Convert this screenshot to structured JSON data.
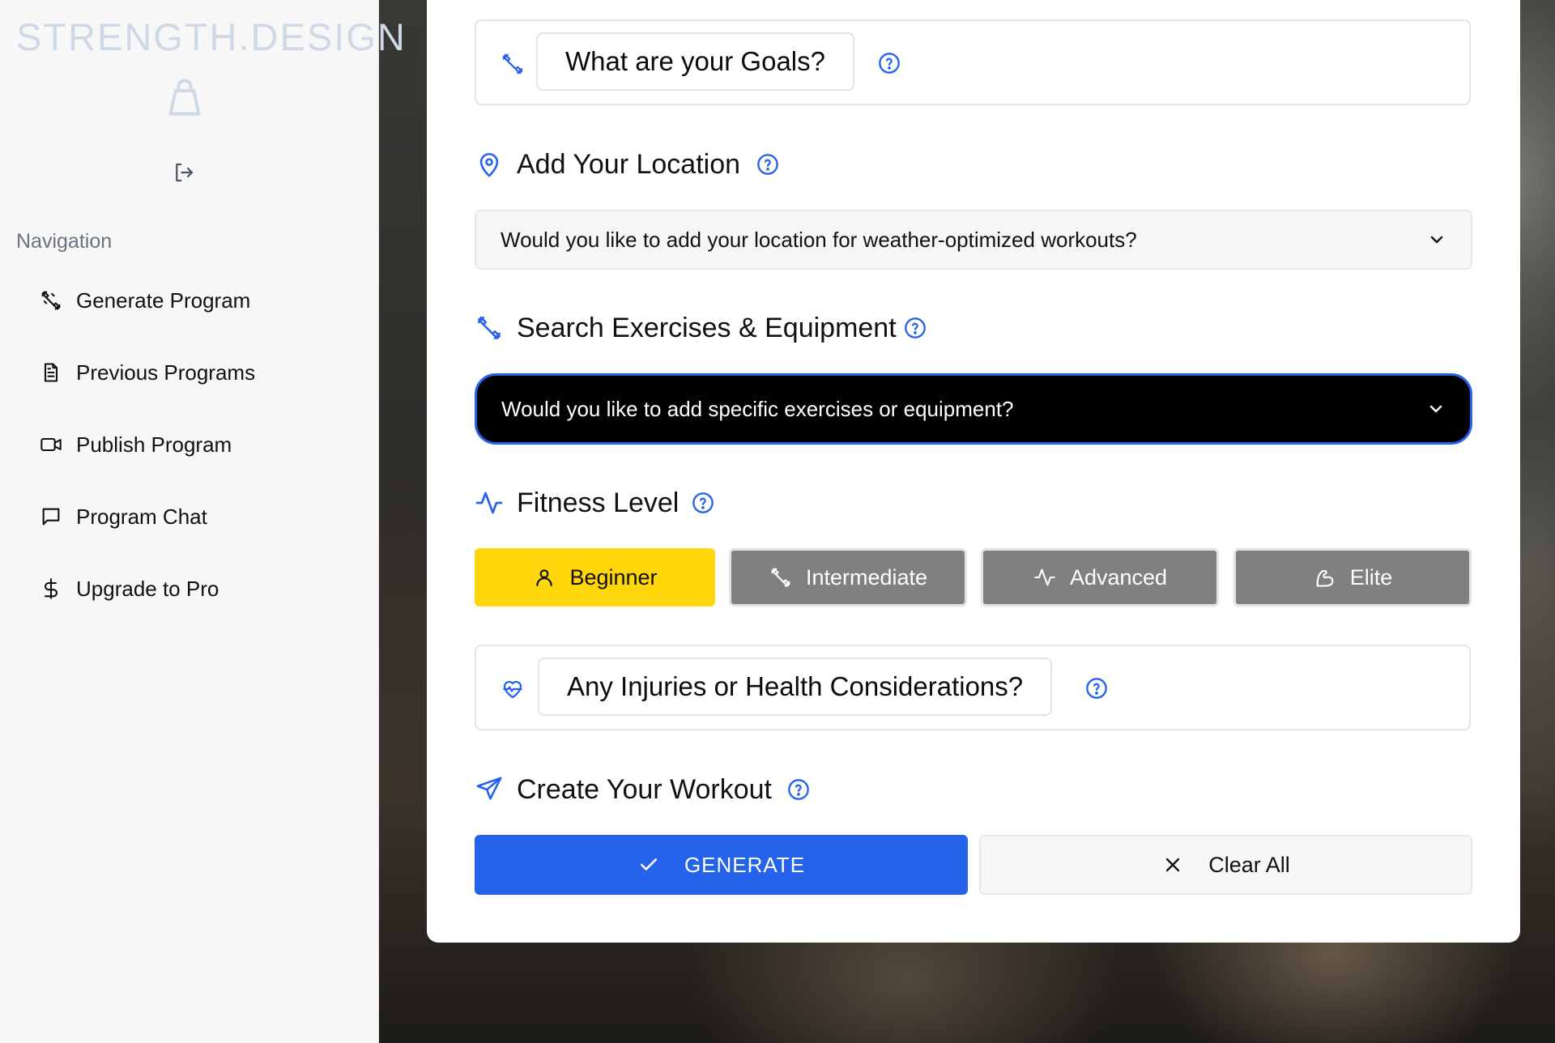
{
  "sidebar": {
    "brand": "STRENGTH.DESIGN",
    "brand_icon": "kettlebell-icon",
    "logout_icon": "logout-icon",
    "nav_heading": "Navigation",
    "items": [
      {
        "label": "Generate Program",
        "icon": "dumbbell-icon"
      },
      {
        "label": "Previous Programs",
        "icon": "document-icon"
      },
      {
        "label": "Publish Program",
        "icon": "video-icon"
      },
      {
        "label": "Program Chat",
        "icon": "chat-icon"
      },
      {
        "label": "Upgrade to Pro",
        "icon": "dollar-icon"
      }
    ]
  },
  "main": {
    "goals": {
      "label": "What are your Goals?",
      "icon": "dumbbell-icon"
    },
    "location": {
      "title": "Add Your Location",
      "icon": "map-pin-icon",
      "dropdown": "Would you like to add your location for weather-optimized workouts?"
    },
    "exercises": {
      "title": "Search Exercises & Equipment",
      "icon": "dumbbell-icon",
      "dropdown": "Would you like to add specific exercises or equipment?"
    },
    "fitness": {
      "title": "Fitness Level",
      "icon": "activity-icon",
      "selected": "Beginner",
      "levels": [
        {
          "label": "Beginner",
          "icon": "user-icon"
        },
        {
          "label": "Intermediate",
          "icon": "dumbbell-icon"
        },
        {
          "label": "Advanced",
          "icon": "activity-icon"
        },
        {
          "label": "Elite",
          "icon": "flexed-arm-icon"
        }
      ]
    },
    "injuries": {
      "label": "Any Injuries or Health Considerations?",
      "icon": "heart-pulse-icon"
    },
    "create": {
      "title": "Create Your Workout",
      "icon": "send-icon",
      "generate_label": "GENERATE",
      "clear_label": "Clear All"
    }
  },
  "colors": {
    "accent": "#2563eb",
    "selected_level": "#ffd60a",
    "unselected_level": "#808080",
    "dark_dropdown": "#000000"
  }
}
